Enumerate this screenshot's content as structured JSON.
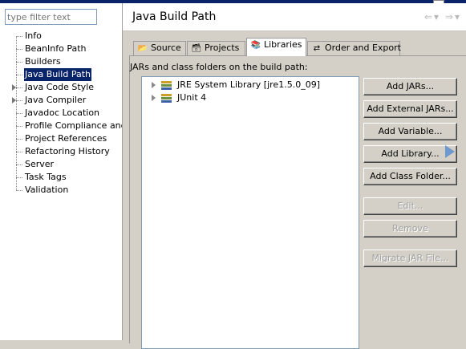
{
  "filter": {
    "placeholder": "type filter text"
  },
  "nav": {
    "items": [
      {
        "label": "Info",
        "expandable": false,
        "selected": false
      },
      {
        "label": "BeanInfo Path",
        "expandable": false,
        "selected": false
      },
      {
        "label": "Builders",
        "expandable": false,
        "selected": false
      },
      {
        "label": "Java Build Path",
        "expandable": false,
        "selected": true
      },
      {
        "label": "Java Code Style",
        "expandable": true,
        "selected": false
      },
      {
        "label": "Java Compiler",
        "expandable": true,
        "selected": false
      },
      {
        "label": "Javadoc Location",
        "expandable": false,
        "selected": false
      },
      {
        "label": "Profile Compliance and Va",
        "expandable": false,
        "selected": false
      },
      {
        "label": "Project References",
        "expandable": false,
        "selected": false
      },
      {
        "label": "Refactoring History",
        "expandable": false,
        "selected": false
      },
      {
        "label": "Server",
        "expandable": false,
        "selected": false
      },
      {
        "label": "Task Tags",
        "expandable": false,
        "selected": false
      },
      {
        "label": "Validation",
        "expandable": false,
        "selected": false
      }
    ]
  },
  "header": {
    "title": "Java Build Path"
  },
  "tabs": [
    {
      "label": "Source",
      "icon": "source-folder-icon",
      "active": false
    },
    {
      "label": "Projects",
      "icon": "projects-icon",
      "active": false
    },
    {
      "label": "Libraries",
      "icon": "libraries-icon",
      "active": true
    },
    {
      "label": "Order and Export",
      "icon": "order-export-icon",
      "active": false
    }
  ],
  "panel": {
    "label": "JARs and class folders on the build path:",
    "entries": [
      {
        "label": "JRE System Library [jre1.5.0_09]",
        "icon": "library-icon"
      },
      {
        "label": "JUnit 4",
        "icon": "library-icon"
      }
    ]
  },
  "buttons": {
    "add_jars": "Add JARs...",
    "add_external_jars": "Add External JARs...",
    "add_variable": "Add Variable...",
    "add_library": "Add Library...",
    "add_class_folder": "Add Class Folder...",
    "edit": "Edit...",
    "remove": "Remove",
    "migrate_jar": "Migrate JAR File..."
  },
  "colors": {
    "selection": "#0a246a",
    "window": "#d4d0c8",
    "accent": "#5b8fd1"
  }
}
